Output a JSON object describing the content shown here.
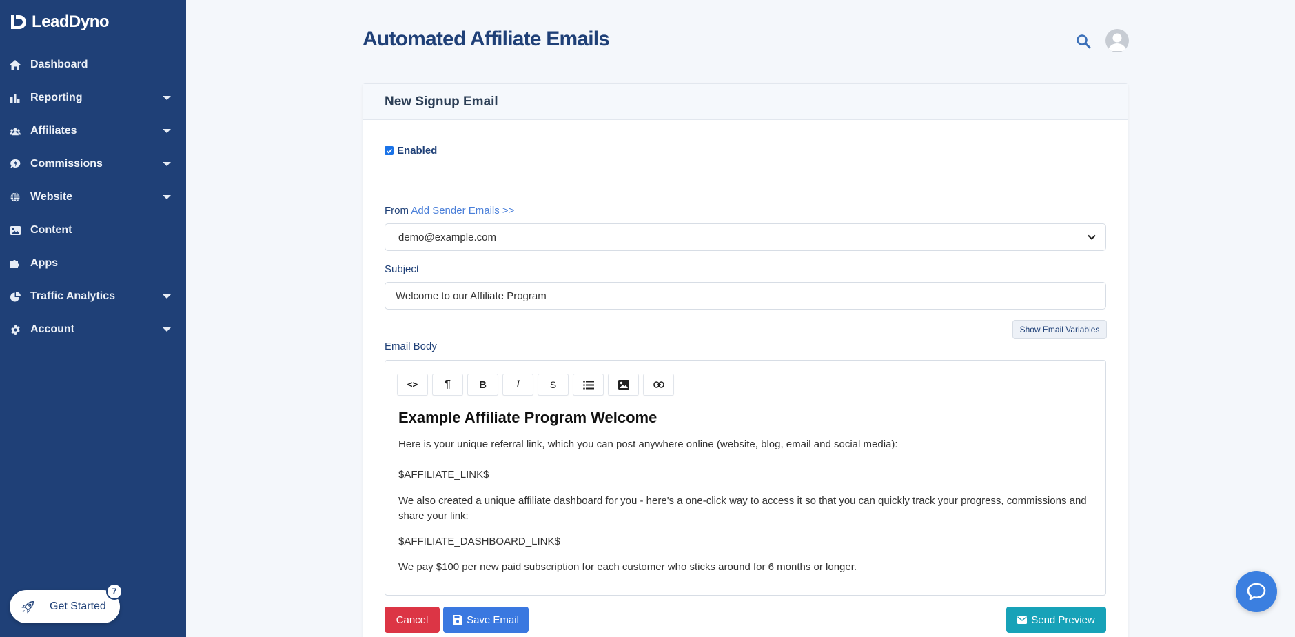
{
  "app": {
    "name": "LeadDyno"
  },
  "sidebar": {
    "items": [
      {
        "label": "Dashboard",
        "icon": "home-icon",
        "expandable": false
      },
      {
        "label": "Reporting",
        "icon": "bar-chart-icon",
        "expandable": true
      },
      {
        "label": "Affiliates",
        "icon": "users-icon",
        "expandable": true
      },
      {
        "label": "Commissions",
        "icon": "money-chat-icon",
        "expandable": true
      },
      {
        "label": "Website",
        "icon": "globe-icon",
        "expandable": true
      },
      {
        "label": "Content",
        "icon": "image-icon",
        "expandable": false
      },
      {
        "label": "Apps",
        "icon": "puzzle-icon",
        "expandable": false
      },
      {
        "label": "Traffic Analytics",
        "icon": "pie-chart-icon",
        "expandable": true
      },
      {
        "label": "Account",
        "icon": "gear-icon",
        "expandable": true
      }
    ],
    "get_started": {
      "label": "Get Started",
      "badge": "7"
    }
  },
  "header": {
    "title": "Automated Affiliate Emails"
  },
  "card": {
    "title": "New Signup Email",
    "enabled_label": "Enabled",
    "enabled": true,
    "from_label": "From",
    "add_sender_link": "Add Sender Emails >>",
    "from_value": "demo@example.com",
    "subject_label": "Subject",
    "subject_value": "Welcome to our Affiliate Program",
    "show_vars_label": "Show Email Variables",
    "body_label": "Email Body",
    "toolbar": {
      "code": "<>",
      "paragraph": "¶",
      "bold": "B",
      "italic": "I",
      "strike": "S"
    },
    "editor": {
      "heading": "Example Affiliate Program Welcome",
      "p1": "Here is your unique referral link, which you can post anywhere online (website, blog, email and social media):",
      "p2": "$AFFILIATE_LINK$",
      "p3": "We also created a unique affiliate dashboard for you - here's a one-click way to access it so that you can quickly track your progress, commissions and share your link:",
      "p4": "$AFFILIATE_DASHBOARD_LINK$",
      "p5": "We pay $100 per new paid subscription for each customer who sticks around for 6 months or longer."
    },
    "buttons": {
      "cancel": "Cancel",
      "save": "Save Email",
      "preview": "Send Preview"
    }
  },
  "colors": {
    "sidebar": "#1f4077",
    "accent": "#3a78e0",
    "danger": "#dc3545",
    "info": "#17a2b8"
  }
}
